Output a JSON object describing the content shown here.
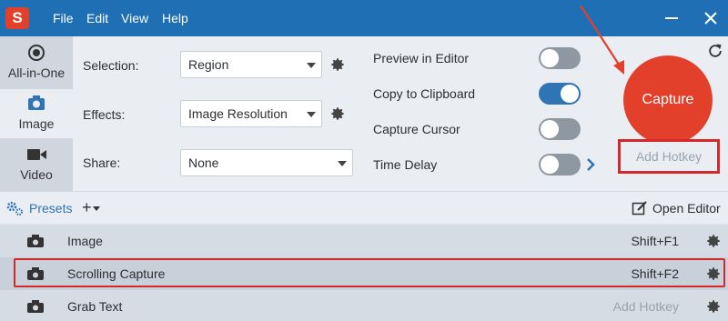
{
  "titlebar": {
    "logo_letter": "S",
    "menu": [
      "File",
      "Edit",
      "View",
      "Help"
    ]
  },
  "tabs": [
    {
      "label": "All-in-One",
      "icon": "all-in-one-icon"
    },
    {
      "label": "Image",
      "icon": "camera-icon"
    },
    {
      "label": "Video",
      "icon": "video-camera-icon"
    }
  ],
  "settings": {
    "selection": {
      "label": "Selection:",
      "value": "Region"
    },
    "effects": {
      "label": "Effects:",
      "value": "Image Resolution"
    },
    "share": {
      "label": "Share:",
      "value": "None"
    }
  },
  "options": {
    "preview_in_editor": {
      "label": "Preview in Editor",
      "on": false
    },
    "copy_to_clipboard": {
      "label": "Copy to Clipboard",
      "on": true
    },
    "capture_cursor": {
      "label": "Capture Cursor",
      "on": false
    },
    "time_delay": {
      "label": "Time Delay",
      "on": false
    }
  },
  "capture": {
    "button_label": "Capture",
    "add_hotkey_label": "Add Hotkey"
  },
  "presets_bar": {
    "label": "Presets",
    "add_label": "+",
    "open_editor_label": "Open Editor"
  },
  "presets": [
    {
      "name": "Image",
      "hotkey": "Shift+F1"
    },
    {
      "name": "Scrolling Capture",
      "hotkey": "Shift+F2"
    },
    {
      "name": "Grab Text",
      "hotkey": "Add Hotkey"
    }
  ],
  "colors": {
    "titlebar": "#1f6fb5",
    "accent": "#2f74b5",
    "capture_red": "#e2402b",
    "highlight_red": "#d4282a"
  }
}
